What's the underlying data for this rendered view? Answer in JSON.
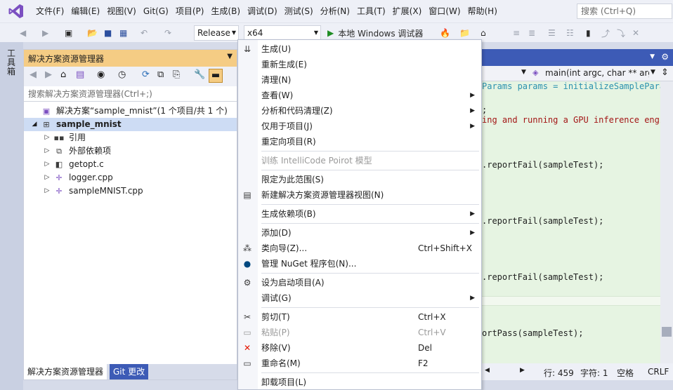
{
  "menubar": {
    "items": [
      "文件(F)",
      "编辑(E)",
      "视图(V)",
      "Git(G)",
      "项目(P)",
      "生成(B)",
      "调试(D)",
      "测试(S)",
      "分析(N)",
      "工具(T)",
      "扩展(X)",
      "窗口(W)",
      "帮助(H)"
    ],
    "search_placeholder": "搜索 (Ctrl+Q)"
  },
  "toolbar": {
    "config": "Release",
    "platform": "x64",
    "run_label": "本地 Windows 调试器"
  },
  "toolstrip": {
    "label": "工具箱"
  },
  "solution_explorer": {
    "title": "解决方案资源管理器",
    "search_placeholder": "搜索解决方案资源管理器(Ctrl+;)",
    "tree": [
      {
        "label": "解决方案“sample_mnist”(1 个项目/共 1 个)",
        "icon": "solution-icon",
        "level": 0,
        "bold": false
      },
      {
        "label": "sample_mnist",
        "icon": "project-icon",
        "level": 0,
        "bold": true
      },
      {
        "label": "引用",
        "icon": "references-icon",
        "level": 1,
        "bold": false
      },
      {
        "label": "外部依赖项",
        "icon": "external-deps-icon",
        "level": 1,
        "bold": false
      },
      {
        "label": "getopt.c",
        "icon": "c-file-icon",
        "level": 1,
        "bold": false
      },
      {
        "label": "logger.cpp",
        "icon": "cpp-file-icon",
        "level": 1,
        "bold": false
      },
      {
        "label": "sampleMNIST.cpp",
        "icon": "cpp-file-icon",
        "level": 1,
        "bold": false
      }
    ],
    "tabs": [
      "解决方案资源管理器",
      "Git 更改"
    ]
  },
  "editor": {
    "nav_function": "main(int argc, char ** argv)",
    "lines": [
      {
        "text": "Params params = initializeSampleParams",
        "kind": "ty"
      },
      {
        "text": ";",
        "kind": "plain"
      },
      {
        "text": "ing and running a GPU inference engine",
        "kind": "str"
      },
      {
        "text": ".reportFail(sampleTest);",
        "kind": "plain"
      },
      {
        "text": ".reportFail(sampleTest);",
        "kind": "plain"
      },
      {
        "text": ".reportFail(sampleTest);",
        "kind": "plain"
      },
      {
        "text": "ortPass(sampleTest);",
        "kind": "plain"
      }
    ],
    "status": {
      "line": "行: 459",
      "col": "字符: 1",
      "ws": "空格",
      "eol": "CRLF"
    }
  },
  "context_menu": {
    "items": [
      {
        "type": "item",
        "label": "生成(U)",
        "icon": "build-icon"
      },
      {
        "type": "item",
        "label": "重新生成(E)"
      },
      {
        "type": "item",
        "label": "清理(N)"
      },
      {
        "type": "item",
        "label": "查看(W)",
        "submenu": true
      },
      {
        "type": "item",
        "label": "分析和代码清理(Z)",
        "submenu": true
      },
      {
        "type": "item",
        "label": "仅用于项目(J)",
        "submenu": true
      },
      {
        "type": "item",
        "label": "重定向项目(R)"
      },
      {
        "type": "sep"
      },
      {
        "type": "item",
        "label": "训练 IntelliCode Poirot 模型",
        "disabled": true
      },
      {
        "type": "sep"
      },
      {
        "type": "item",
        "label": "限定为此范围(S)"
      },
      {
        "type": "item",
        "label": "新建解决方案资源管理器视图(N)",
        "icon": "new-view-icon"
      },
      {
        "type": "sep"
      },
      {
        "type": "item",
        "label": "生成依赖项(B)",
        "submenu": true
      },
      {
        "type": "sep"
      },
      {
        "type": "item",
        "label": "添加(D)",
        "submenu": true
      },
      {
        "type": "item",
        "label": "类向导(Z)...",
        "shortcut": "Ctrl+Shift+X",
        "icon": "class-wizard-icon"
      },
      {
        "type": "item",
        "label": "管理 NuGet 程序包(N)...",
        "icon": "nuget-icon"
      },
      {
        "type": "sep"
      },
      {
        "type": "item",
        "label": "设为启动项目(A)",
        "icon": "gear-icon"
      },
      {
        "type": "item",
        "label": "调试(G)",
        "submenu": true
      },
      {
        "type": "sep"
      },
      {
        "type": "item",
        "label": "剪切(T)",
        "shortcut": "Ctrl+X",
        "icon": "scissors-icon"
      },
      {
        "type": "item",
        "label": "粘贴(P)",
        "shortcut": "Ctrl+V",
        "icon": "paste-icon",
        "disabled": true
      },
      {
        "type": "item",
        "label": "移除(V)",
        "shortcut": "Del",
        "icon": "remove-icon"
      },
      {
        "type": "item",
        "label": "重命名(M)",
        "shortcut": "F2",
        "icon": "rename-icon"
      },
      {
        "type": "sep"
      },
      {
        "type": "item",
        "label": "卸载项目(L)"
      }
    ]
  },
  "colors": {
    "accent": "#3d5bb6",
    "panel_title": "#f5cc84",
    "code_background": "#e6f4e2",
    "remove_icon": "#e51400",
    "run_icon": "#1e8c23"
  }
}
